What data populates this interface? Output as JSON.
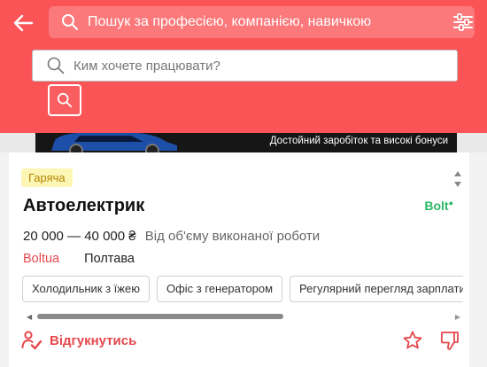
{
  "header": {
    "search_placeholder": "Пошук за професією, компанією, навичкою",
    "sub_search_placeholder": "Ким хочете працювати?",
    "accent_color": "#fa5457"
  },
  "banner": {
    "text": "Достойний заробіток та високі бонуси"
  },
  "job": {
    "badge": "Гаряча",
    "title": "Автоелектрик",
    "company_logo": "Bolt",
    "salary": "20 000 — 40 000 ₴",
    "salary_note": "Від об'єму виконаної роботи",
    "company": "Boltua",
    "city": "Полтава",
    "tags": [
      "Холодильник з їжею",
      "Офіс з генератором",
      "Регулярний перегляд зарплати"
    ],
    "apply_label": "Відгукнутись"
  },
  "icons": {
    "back": "arrow-left-icon",
    "search": "search-icon",
    "filter": "filter-sliders-icon",
    "star": "star-icon",
    "dislike": "thumbs-down-icon"
  }
}
